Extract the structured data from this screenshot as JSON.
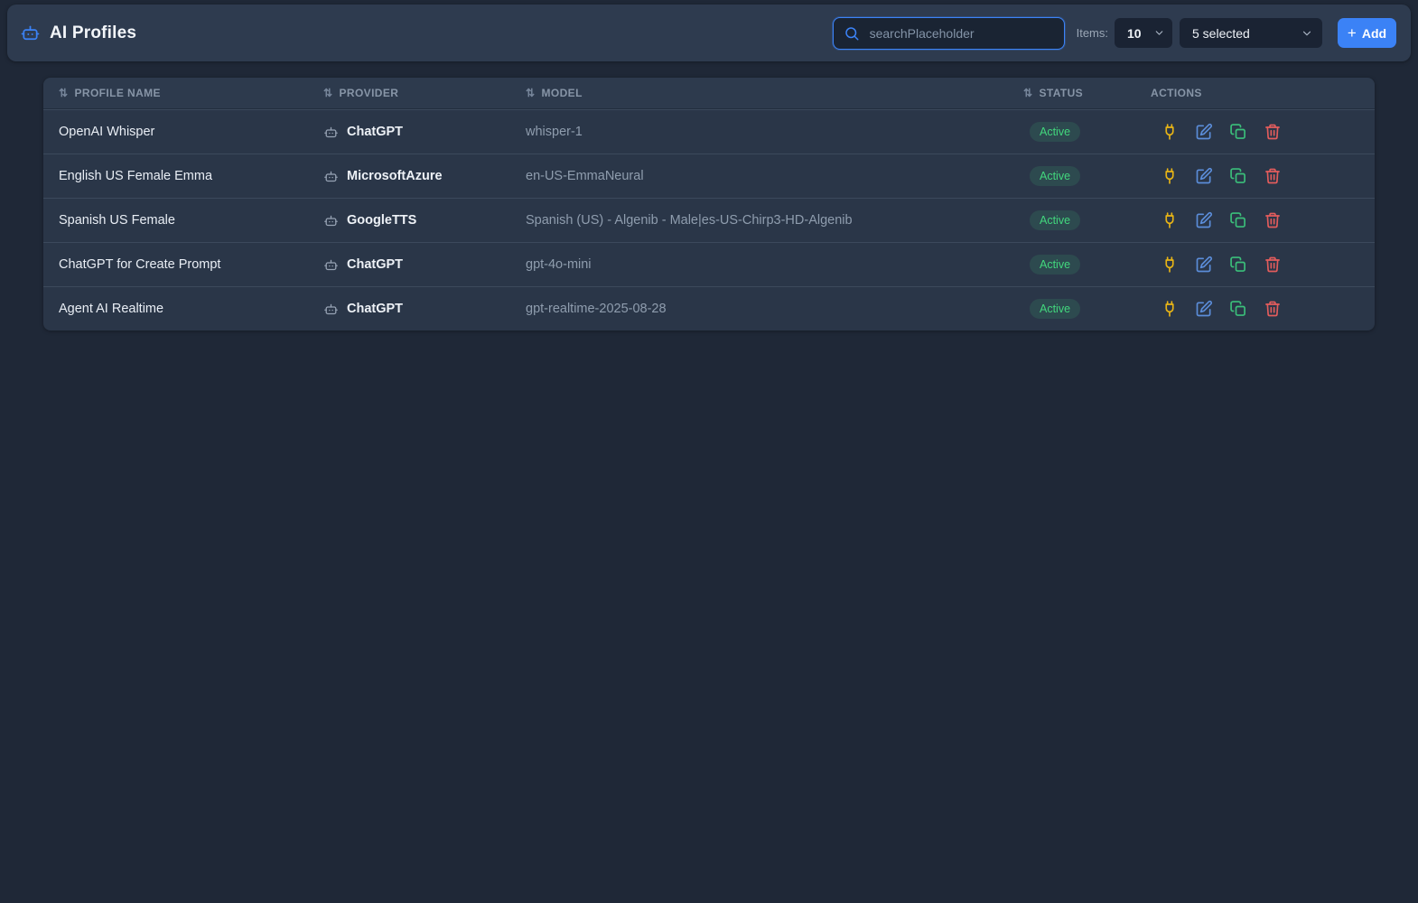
{
  "header": {
    "title": "AI Profiles",
    "search_placeholder": "searchPlaceholder",
    "items_label": "Items:",
    "items_value": "10",
    "selected_value": "5 selected",
    "add_label": "Add"
  },
  "icons": {
    "sort": "⇅",
    "plus": "+"
  },
  "colors": {
    "accent_blue": "#3b82f6",
    "status_green": "#42d77d",
    "action_yellow": "#e7b416",
    "action_edit_blue": "#5b8dd9",
    "action_copy_green": "#3bbf7a",
    "action_delete_red": "#e25c5c"
  },
  "table": {
    "columns": [
      {
        "label": "PROFILE NAME",
        "sortable": true
      },
      {
        "label": "PROVIDER",
        "sortable": true
      },
      {
        "label": "MODEL",
        "sortable": true
      },
      {
        "label": "STATUS",
        "sortable": true
      },
      {
        "label": "ACTIONS",
        "sortable": false
      }
    ],
    "action_names": [
      "test-connection",
      "edit",
      "duplicate",
      "delete"
    ],
    "rows": [
      {
        "name": "OpenAI Whisper",
        "provider": "ChatGPT",
        "model": "whisper-1",
        "status": "Active"
      },
      {
        "name": "English US Female Emma",
        "provider": "MicrosoftAzure",
        "model": "en-US-EmmaNeural",
        "status": "Active"
      },
      {
        "name": "Spanish US Female",
        "provider": "GoogleTTS",
        "model": "Spanish (US) - Algenib - Male|es-US-Chirp3-HD-Algenib",
        "status": "Active"
      },
      {
        "name": "ChatGPT for Create Prompt",
        "provider": "ChatGPT",
        "model": "gpt-4o-mini",
        "status": "Active"
      },
      {
        "name": "Agent AI Realtime",
        "provider": "ChatGPT",
        "model": "gpt-realtime-2025-08-28",
        "status": "Active"
      }
    ]
  }
}
